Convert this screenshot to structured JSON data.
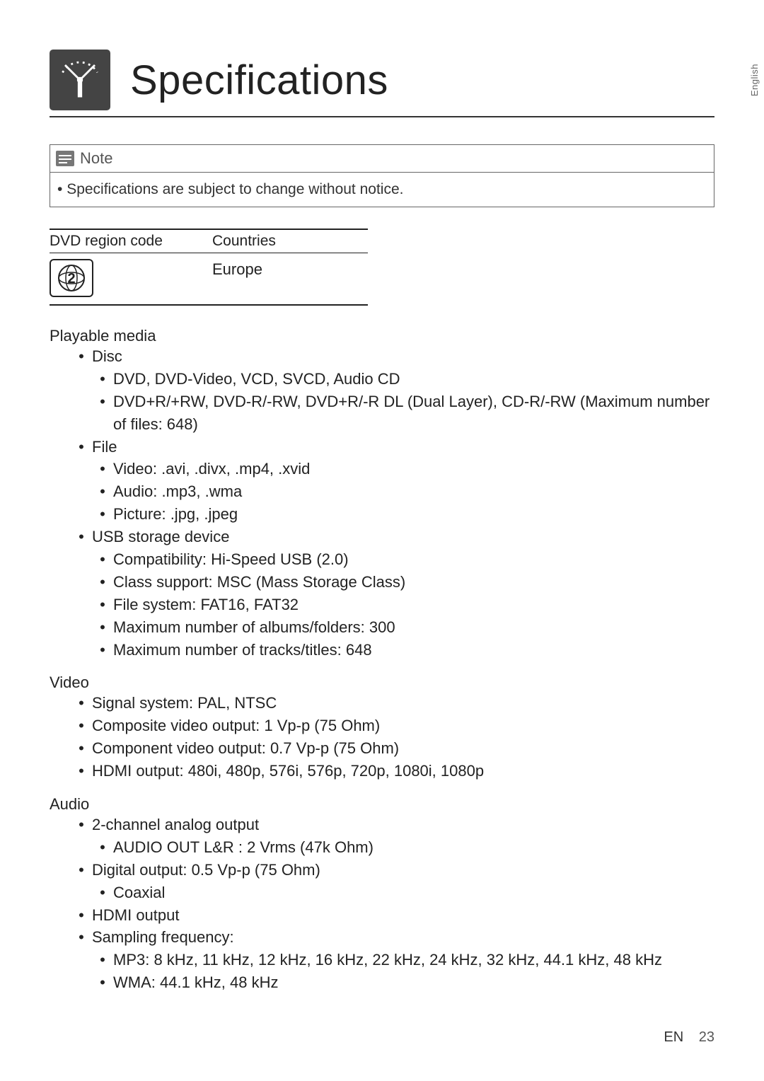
{
  "side_tab": "English",
  "header": {
    "title": "Specifications"
  },
  "note": {
    "label": "Note",
    "text": "Specifications are subject to change without notice."
  },
  "region_table": {
    "col1": "DVD region code",
    "col2": "Countries",
    "region_number": "2",
    "country": "Europe"
  },
  "sections": {
    "playable_media": {
      "heading": "Playable media",
      "disc_label": "Disc",
      "disc_items": [
        "DVD, DVD-Video, VCD, SVCD, Audio CD",
        "DVD+R/+RW, DVD-R/-RW, DVD+R/-R DL (Dual Layer), CD-R/-RW (Maximum number of files: 648)"
      ],
      "file_label": "File",
      "file_items": [
        "Video: .avi, .divx, .mp4, .xvid",
        "Audio: .mp3, .wma",
        "Picture: .jpg, .jpeg"
      ],
      "usb_label": "USB storage device",
      "usb_items": [
        "Compatibility: Hi-Speed USB (2.0)",
        "Class support: MSC (Mass Storage Class)",
        "File system: FAT16, FAT32",
        "Maximum number of albums/folders: 300",
        "Maximum number of tracks/titles: 648"
      ]
    },
    "video": {
      "heading": "Video",
      "items": [
        "Signal system: PAL, NTSC",
        "Composite video output: 1 Vp-p (75 Ohm)",
        "Component video output: 0.7 Vp-p (75 Ohm)",
        "HDMI output: 480i, 480p, 576i, 576p, 720p, 1080i, 1080p"
      ]
    },
    "audio": {
      "heading": "Audio",
      "analog_label": "2-channel analog output",
      "analog_sub": "AUDIO OUT L&R : 2 Vrms (47k Ohm)",
      "digital_label": "Digital output: 0.5 Vp-p (75 Ohm)",
      "digital_sub": "Coaxial",
      "hdmi": "HDMI output",
      "sampling_label": "Sampling frequency:",
      "sampling_items": [
        "MP3: 8 kHz, 11 kHz, 12 kHz, 16 kHz, 22 kHz, 24 kHz, 32 kHz, 44.1 kHz, 48 kHz",
        "WMA: 44.1 kHz, 48 kHz"
      ]
    }
  },
  "footer": {
    "lang": "EN",
    "page": "23"
  }
}
